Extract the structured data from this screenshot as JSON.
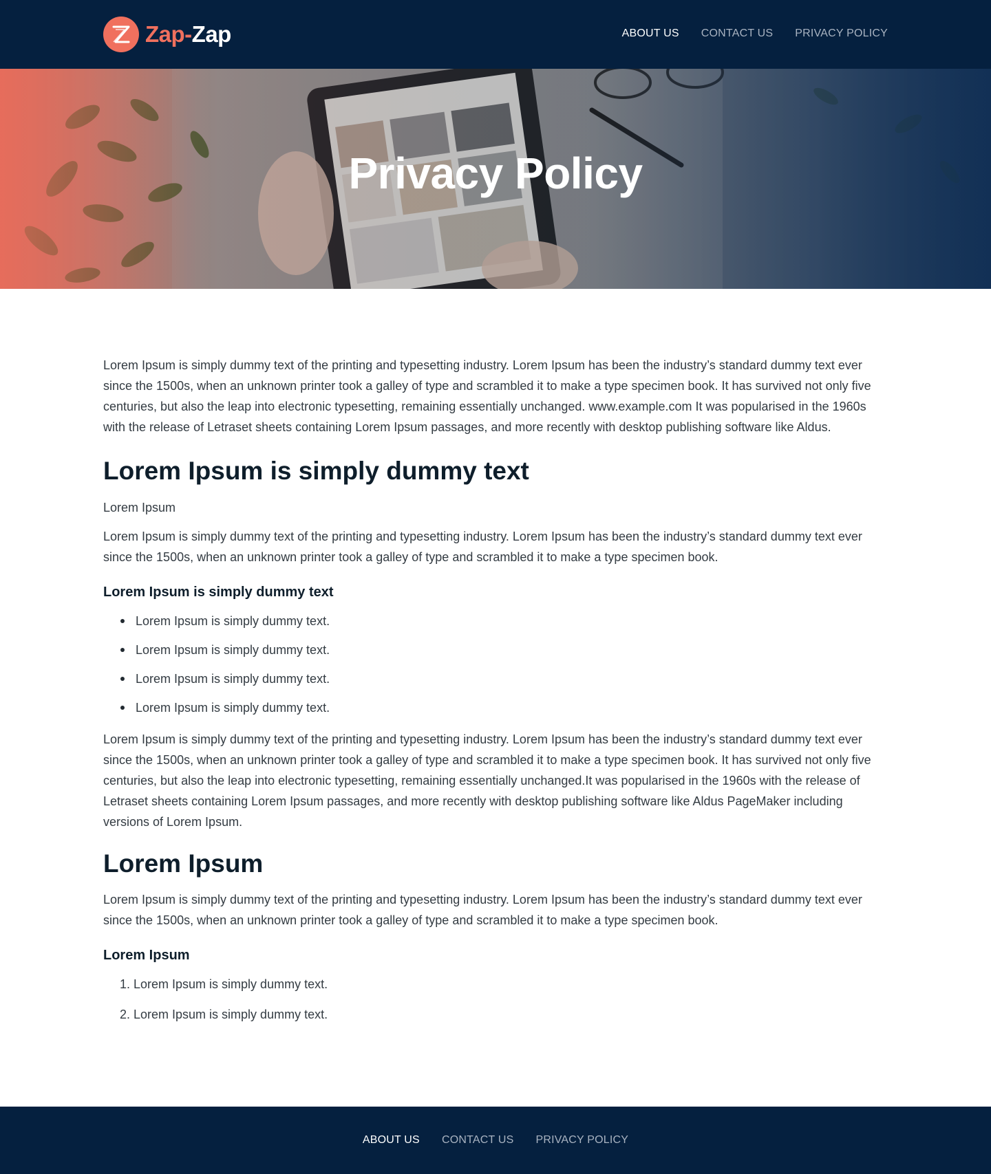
{
  "header": {
    "logo": {
      "part1": "Zap",
      "dash": "-",
      "part2": "Zap",
      "badge_letter": "Z"
    },
    "nav": [
      {
        "label": "ABOUT US",
        "active": true
      },
      {
        "label": "CONTACT US",
        "active": false
      },
      {
        "label": "PRIVACY POLICY",
        "active": false
      }
    ]
  },
  "hero": {
    "title": "Privacy Policy"
  },
  "content": {
    "intro": "Lorem Ipsum is simply dummy text of the printing and typesetting industry. Lorem Ipsum has been the industry’s standard dummy text ever since the 1500s, when an unknown printer took a galley of type and scrambled it to make a type specimen book. It has survived not only five centuries, but also the leap into electronic typesetting, remaining essentially unchanged. www.example.com It was popularised in the 1960s with the release of Letraset sheets containing Lorem Ipsum passages, and more recently with desktop publishing software like Aldus.",
    "section1": {
      "heading": "Lorem Ipsum is simply dummy text",
      "subtext": "Lorem Ipsum",
      "paragraph": "Lorem Ipsum is simply dummy text of the printing and typesetting industry. Lorem Ipsum has been the industry’s standard dummy text ever since the 1500s, when an unknown printer took a galley of type and scrambled it to make a type specimen book.",
      "subheading": "Lorem Ipsum is simply dummy text",
      "bullets": [
        "Lorem Ipsum is simply dummy text.",
        "Lorem Ipsum is simply dummy text.",
        "Lorem Ipsum is simply dummy text.",
        "Lorem Ipsum is simply dummy text."
      ],
      "paragraph2": "Lorem Ipsum is simply dummy text of the printing and typesetting industry. Lorem Ipsum has been the industry’s standard dummy text ever since the 1500s, when an unknown printer took a galley of type and scrambled it to make a type specimen book. It has survived not only five centuries, but also the leap into electronic typesetting, remaining essentially unchanged.It was popularised in the 1960s with the release of Letraset sheets containing Lorem Ipsum passages, and more recently with desktop publishing software like Aldus PageMaker including versions of Lorem Ipsum."
    },
    "section2": {
      "heading": "Lorem Ipsum",
      "paragraph": "Lorem Ipsum is simply dummy text of the printing and typesetting industry. Lorem Ipsum has been the industry’s standard dummy text ever since the 1500s, when an unknown printer took a galley of type and scrambled it to make a type specimen book.",
      "subheading": "Lorem Ipsum",
      "ordered": [
        {
          "num": "1.",
          "text": "Lorem Ipsum is simply dummy text."
        },
        {
          "num": "2.",
          "text": "Lorem Ipsum is simply dummy text."
        }
      ]
    }
  },
  "footer": {
    "nav": [
      {
        "label": "ABOUT US",
        "active": true
      },
      {
        "label": "CONTACT US",
        "active": false
      },
      {
        "label": "PRIVACY POLICY",
        "active": false
      }
    ]
  },
  "colors": {
    "navy": "#05203f",
    "accent": "#f0705e",
    "heading": "#0e1e2b",
    "body_text": "#333b42",
    "nav_inactive": "#a9b3c1"
  }
}
